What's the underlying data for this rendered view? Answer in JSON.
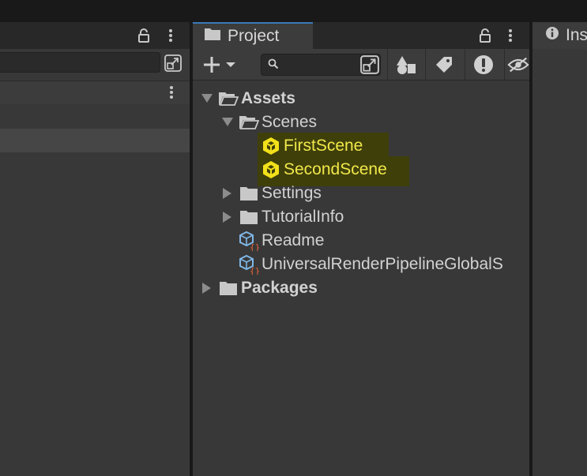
{
  "project_panel": {
    "tab_label": "Project",
    "tree": [
      {
        "label": "Assets",
        "bold": true,
        "expanded": true,
        "depth": 0,
        "icon": "folder-open-icon"
      },
      {
        "label": "Scenes",
        "bold": false,
        "expanded": true,
        "depth": 1,
        "icon": "folder-open-icon"
      },
      {
        "label": "FirstScene",
        "bold": false,
        "depth": 2,
        "icon": "unity-scene-icon",
        "highlighted": true
      },
      {
        "label": "SecondScene",
        "bold": false,
        "depth": 2,
        "icon": "unity-scene-icon",
        "highlighted": true
      },
      {
        "label": "Settings",
        "bold": false,
        "expanded": false,
        "depth": 1,
        "icon": "folder-icon"
      },
      {
        "label": "TutorialInfo",
        "bold": false,
        "expanded": false,
        "depth": 1,
        "icon": "folder-icon"
      },
      {
        "label": "Readme",
        "bold": false,
        "depth": 1,
        "icon": "scriptable-object-icon"
      },
      {
        "label": "UniversalRenderPipelineGlobalS",
        "bold": false,
        "depth": 1,
        "icon": "scriptable-object-icon"
      },
      {
        "label": "Packages",
        "bold": true,
        "expanded": false,
        "depth": 0,
        "icon": "folder-icon"
      }
    ]
  },
  "inspector_panel": {
    "tab_label": "Ins"
  },
  "colors": {
    "background": "#383838",
    "tab_strip": "#282828",
    "highlight": "#3f3f0a",
    "highlight_text": "#f1e84a",
    "scene_icon": "#f2e11a",
    "text": "#d2d2d2",
    "active_tab_border": "#3a79bb"
  }
}
